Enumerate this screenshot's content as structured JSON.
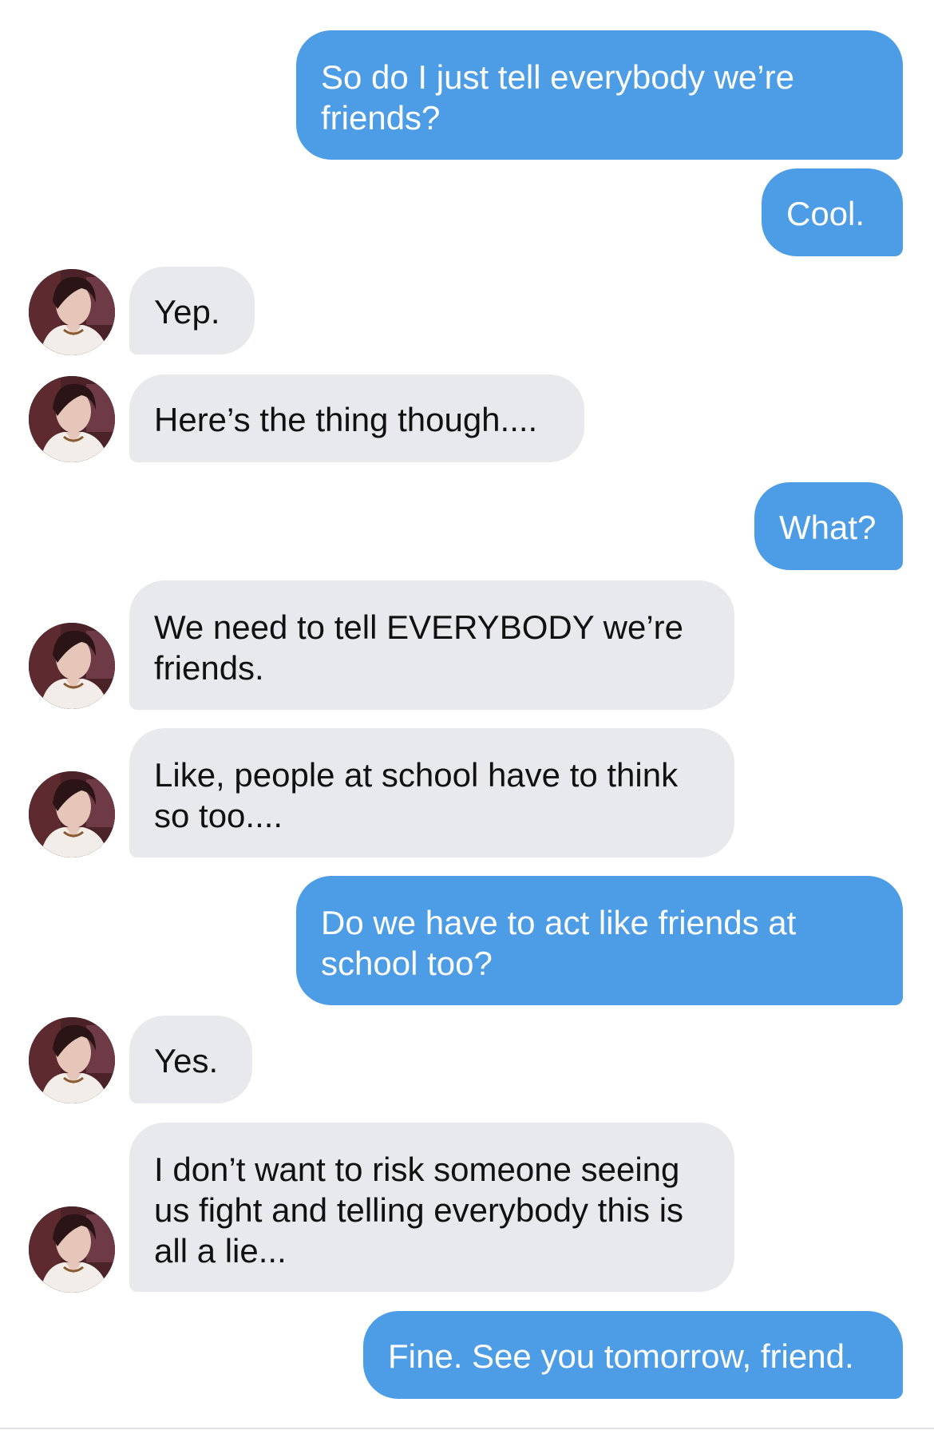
{
  "conversation": {
    "messages": [
      {
        "sender": "me",
        "text": "So do I just tell everybody we’re friends?"
      },
      {
        "sender": "me",
        "text": "Cool."
      },
      {
        "sender": "them",
        "text": "Yep."
      },
      {
        "sender": "them",
        "text": "Here’s the thing though...."
      },
      {
        "sender": "me",
        "text": "What?"
      },
      {
        "sender": "them",
        "text": "We need to tell EVERYBODY we’re friends."
      },
      {
        "sender": "them",
        "text": "Like, people at school have to think so too...."
      },
      {
        "sender": "me",
        "text": "Do we have to act like friends at school too?"
      },
      {
        "sender": "them",
        "text": "Yes."
      },
      {
        "sender": "them",
        "text": "I don’t want to risk someone seeing us fight and telling everybody this is all a lie..."
      },
      {
        "sender": "me",
        "text": "Fine. See you tomorrow, friend."
      }
    ]
  },
  "colors": {
    "outgoing_bubble": "#4d9ce6",
    "incoming_bubble": "#e8e9ed",
    "outgoing_text": "#ffffff",
    "incoming_text": "#111111"
  },
  "icons": {
    "avatar": "contact-avatar-photo"
  }
}
